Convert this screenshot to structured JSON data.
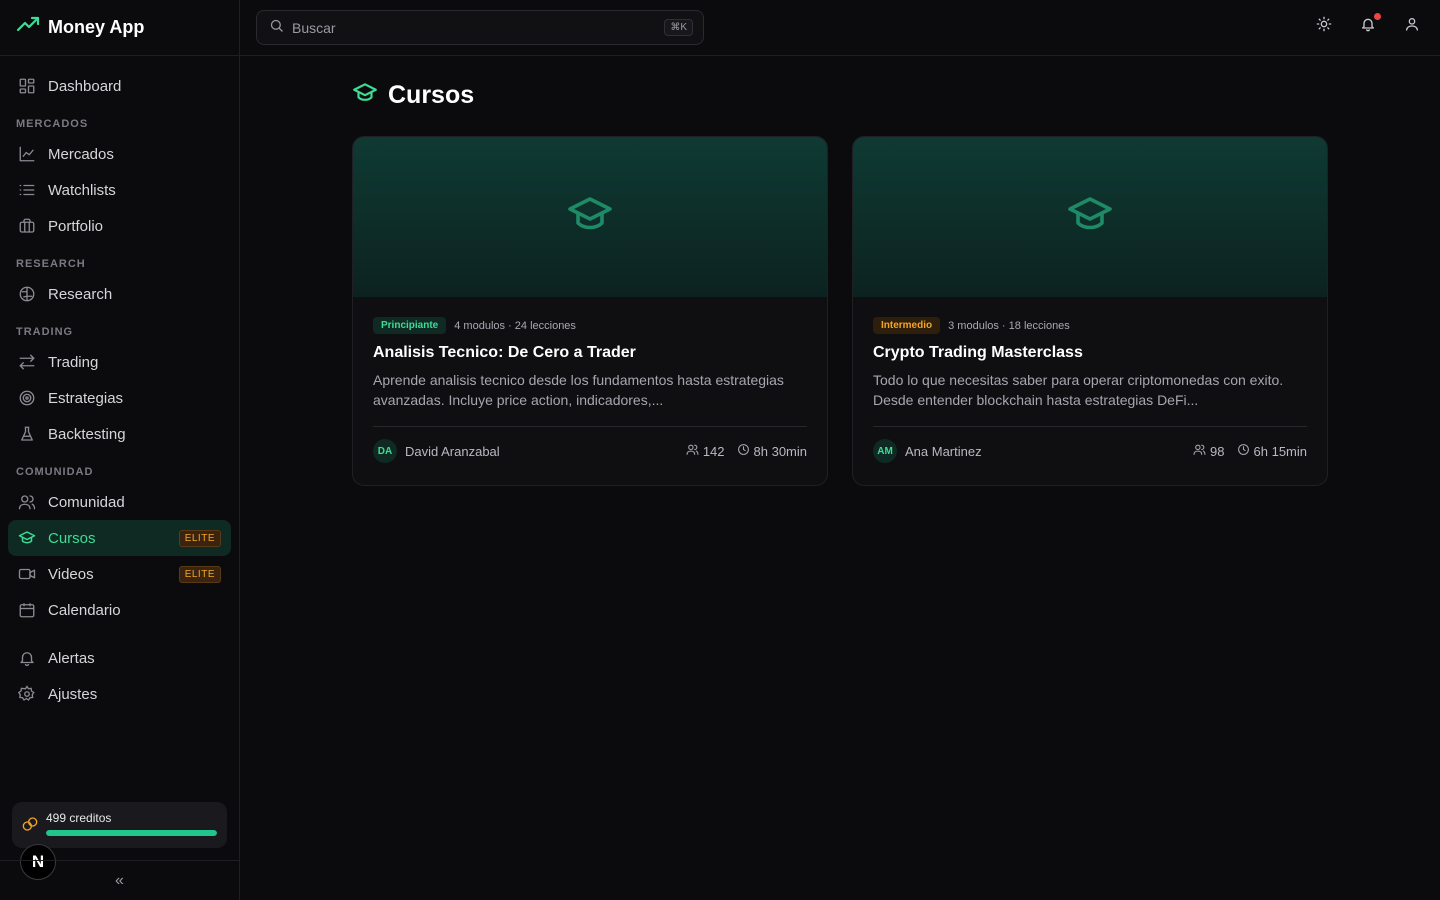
{
  "app": {
    "name": "Money App"
  },
  "sidebar": {
    "dashboard": "Dashboard",
    "sections": {
      "mercados": "MERCADOS",
      "research": "RESEARCH",
      "trading": "TRADING",
      "comunidad": "COMUNIDAD"
    },
    "items": {
      "mercados": "Mercados",
      "watchlists": "Watchlists",
      "portfolio": "Portfolio",
      "research": "Research",
      "trading": "Trading",
      "estrategias": "Estrategias",
      "backtesting": "Backtesting",
      "comunidad": "Comunidad",
      "cursos": "Cursos",
      "videos": "Videos",
      "calendario": "Calendario",
      "alertas": "Alertas",
      "ajustes": "Ajustes"
    },
    "elite_badge": "ELITE",
    "credits": {
      "label": "499 creditos",
      "progress_fraction": 1.0
    },
    "user_initial": "N",
    "collapse_glyph": "«"
  },
  "topbar": {
    "search_placeholder": "Buscar",
    "shortcut": "⌘K",
    "icons": [
      "sun-icon",
      "bell-icon",
      "user-icon"
    ]
  },
  "page": {
    "title": "Cursos"
  },
  "courses": [
    {
      "level": "Principiante",
      "meta": "4 modulos · 24 lecciones",
      "title": "Analisis Tecnico: De Cero a Trader",
      "description": "Aprende analisis tecnico desde los fundamentos hasta estrategias avanzadas. Incluye price action, indicadores,...",
      "author_initials": "DA",
      "author": "David Aranzabal",
      "students": "142",
      "duration": "8h 30min"
    },
    {
      "level": "Intermedio",
      "meta": "3 modulos · 18 lecciones",
      "title": "Crypto Trading Masterclass",
      "description": "Todo lo que necesitas saber para operar criptomonedas con exito. Desde entender blockchain hasta estrategias DeFi...",
      "author_initials": "AM",
      "author": "Ana Martinez",
      "students": "98",
      "duration": "6h 15min"
    }
  ],
  "colors": {
    "accent": "#3ddc97",
    "elite": "#f5a524",
    "notification": "#ef4444"
  }
}
